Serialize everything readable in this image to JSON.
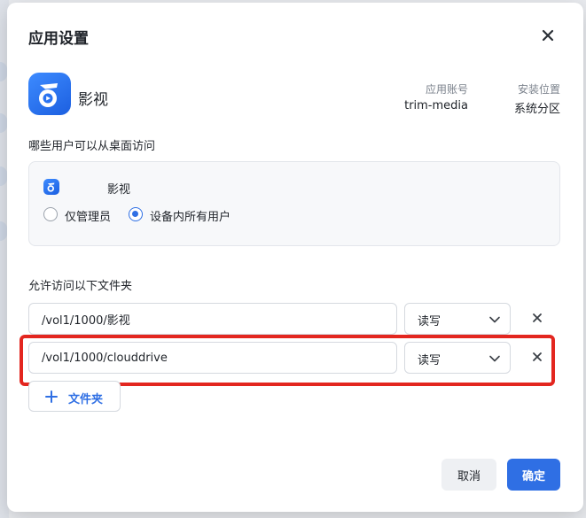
{
  "dialog": {
    "title": "应用设置",
    "close_icon": "close-icon"
  },
  "app": {
    "name": "影视",
    "icon": "fn-media-app-icon",
    "account_label": "应用账号",
    "account_value": "trim-media",
    "location_label": "安装位置",
    "location_value": "系统分区"
  },
  "access": {
    "section_label": "哪些用户可以从桌面访问",
    "app_name": "影视",
    "options": [
      {
        "label": "仅管理员",
        "checked": false
      },
      {
        "label": "设备内所有用户",
        "checked": true
      }
    ]
  },
  "folders": {
    "section_label": "允许访问以下文件夹",
    "rows": [
      {
        "path": "/vol1/1000/影视",
        "permission": "读写"
      },
      {
        "path": "/vol1/1000/clouddrive",
        "permission": "读写"
      }
    ],
    "add_label": "文件夹"
  },
  "footer": {
    "cancel_label": "取消",
    "ok_label": "确定"
  },
  "colors": {
    "accent": "#2f6fe4",
    "highlight": "#e3261f"
  }
}
